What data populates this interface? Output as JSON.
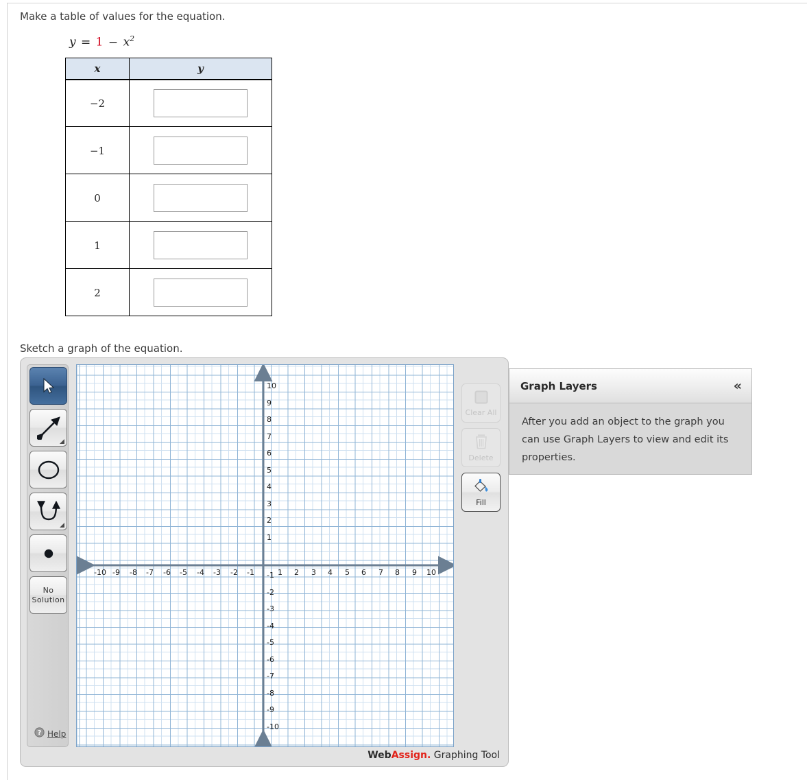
{
  "prompts": {
    "table": "Make a table of values for the equation.",
    "graph": "Sketch a graph of the equation."
  },
  "equation": {
    "lhs": "y",
    "equals": "=",
    "constant": "1",
    "minus": "−",
    "variable": "x",
    "exponent": "2",
    "full": "y = 1 − x2",
    "constant_color": "#d0021b"
  },
  "table": {
    "headers": {
      "x": "x",
      "y": "y"
    },
    "header_bg": "#dbe5f1",
    "rows": [
      {
        "x": "−2",
        "y_value": "",
        "y_placeholder": ""
      },
      {
        "x": "−1",
        "y_value": "",
        "y_placeholder": ""
      },
      {
        "x": "0",
        "y_value": "",
        "y_placeholder": ""
      },
      {
        "x": "1",
        "y_value": "",
        "y_placeholder": ""
      },
      {
        "x": "2",
        "y_value": "",
        "y_placeholder": ""
      }
    ]
  },
  "graph_tool": {
    "tools": [
      {
        "name": "select",
        "icon": "cursor-arrow-icon",
        "label": "",
        "selected": true,
        "has_dropdown": false
      },
      {
        "name": "line",
        "icon": "double-arrow-icon",
        "label": "",
        "selected": false,
        "has_dropdown": true
      },
      {
        "name": "circle",
        "icon": "circle-icon",
        "label": "",
        "selected": false,
        "has_dropdown": false
      },
      {
        "name": "parabola",
        "icon": "parabola-icon",
        "label": "",
        "selected": false,
        "has_dropdown": true
      },
      {
        "name": "point",
        "icon": "filled-dot-icon",
        "label": "",
        "selected": false,
        "has_dropdown": false
      },
      {
        "name": "no-solution",
        "icon": "",
        "label_line1": "No",
        "label_line2": "Solution",
        "selected": false,
        "has_dropdown": false
      }
    ],
    "help": {
      "label": "Help",
      "icon": "question-mark-icon"
    },
    "actions": [
      {
        "name": "clear-all",
        "label": "Clear All",
        "icon": "stop-square-icon",
        "enabled": false
      },
      {
        "name": "delete",
        "label": "Delete",
        "icon": "trash-can-icon",
        "enabled": false
      },
      {
        "name": "fill",
        "label": "Fill",
        "icon": "paint-bucket-icon",
        "enabled": true
      }
    ],
    "branding": {
      "web": "Web",
      "assign": "Assign.",
      "tool": " Graphing Tool",
      "accent_color": "#e2231a"
    }
  },
  "layers_panel": {
    "title": "Graph Layers",
    "collapse_icon": "«",
    "body": "After you add an object to the graph you can use Graph Layers to view and edit its properties."
  },
  "chart_data": {
    "type": "line",
    "title": "",
    "xlabel": "",
    "ylabel": "",
    "xlim": [
      -11,
      11
    ],
    "ylim": [
      -11,
      11
    ],
    "grid": true,
    "minor_grid": true,
    "legend": "none",
    "x_ticks": [
      -10,
      -9,
      -8,
      -7,
      -6,
      -5,
      -4,
      -3,
      -2,
      -1,
      1,
      2,
      3,
      4,
      5,
      6,
      7,
      8,
      9,
      10
    ],
    "y_ticks": [
      10,
      9,
      8,
      7,
      6,
      5,
      4,
      3,
      2,
      1,
      -1,
      -2,
      -3,
      -4,
      -5,
      -6,
      -7,
      -8,
      -9,
      -10
    ],
    "x_tick_labels": [
      "-10",
      "-9",
      "-8",
      "-7",
      "-6",
      "-5",
      "-4",
      "-3",
      "-2",
      "-1",
      "1",
      "2",
      "3",
      "4",
      "5",
      "6",
      "7",
      "8",
      "9",
      "10"
    ],
    "y_tick_labels": [
      "10",
      "9",
      "8",
      "7",
      "6",
      "5",
      "4",
      "3",
      "2",
      "1",
      "-1",
      "-2",
      "-3",
      "-4",
      "-5",
      "-6",
      "-7",
      "-8",
      "-9",
      "-10"
    ],
    "series": [],
    "axis_color": "#6b7f93",
    "major_grid_color": "#8fb4d6",
    "minor_grid_color": "#cfe0f0"
  }
}
